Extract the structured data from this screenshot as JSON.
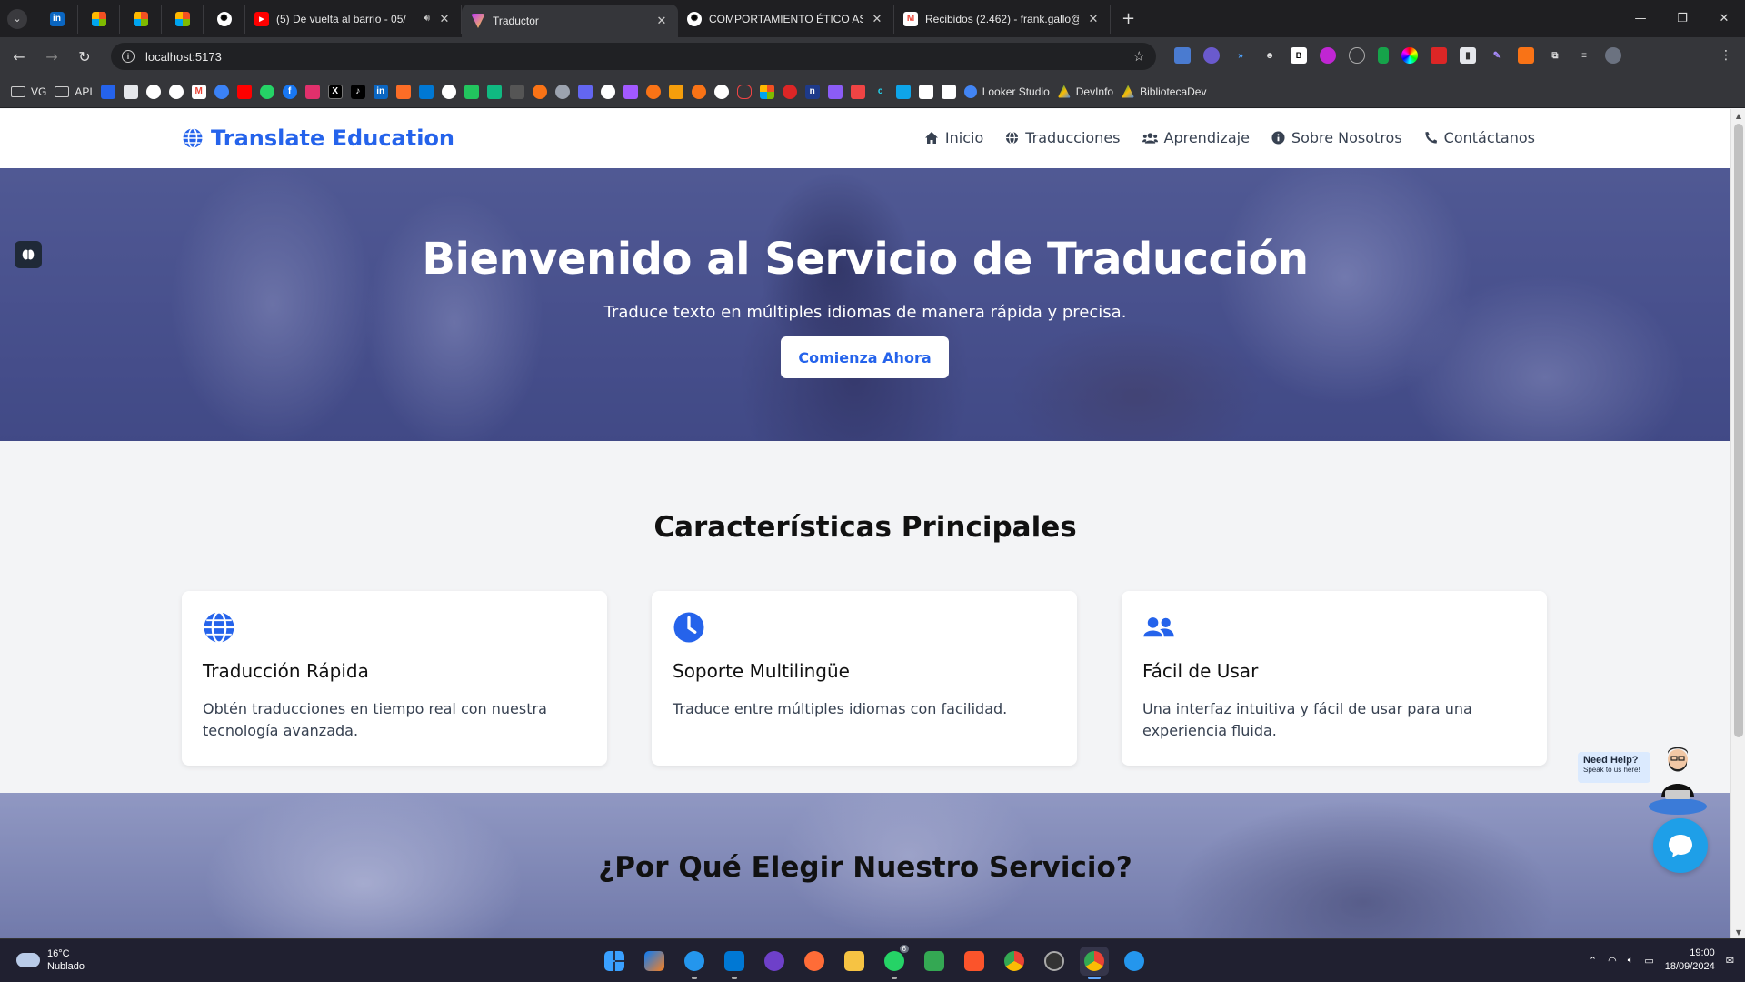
{
  "browser": {
    "tabs": [
      {
        "title": "(5) De vuelta al barrio - 05/",
        "favicon": "youtube-icon",
        "active": false
      },
      {
        "title": "Traductor",
        "favicon": "vite-icon",
        "active": true
      },
      {
        "title": "COMPORTAMIENTO ÉTICO AS",
        "favicon": "chatgpt-icon",
        "active": false
      },
      {
        "title": "Recibidos (2.462) - frank.gallo@",
        "favicon": "gmail-icon",
        "active": false
      }
    ],
    "url": "localhost:5173",
    "bookmarks": {
      "folder_1": "VG",
      "folder_2": "API",
      "named_1": "Looker Studio",
      "named_2": "DevInfo",
      "named_3": "BibliotecaDev"
    }
  },
  "site": {
    "brand": "Translate Education",
    "nav": {
      "inicio": "Inicio",
      "traducciones": "Traducciones",
      "aprendizaje": "Aprendizaje",
      "sobre": "Sobre Nosotros",
      "contacto": "Contáctanos"
    },
    "hero": {
      "title": "Bienvenido al Servicio de Traducción",
      "subtitle": "Traduce texto en múltiples idiomas de manera rápida y precisa.",
      "cta": "Comienza Ahora"
    },
    "features": {
      "title": "Características Principales",
      "items": [
        {
          "icon": "globe-icon",
          "title": "Traducción Rápida",
          "text": "Obtén traducciones en tiempo real con nuestra tecnología avanzada."
        },
        {
          "icon": "clock-icon",
          "title": "Soporte Multilingüe",
          "text": "Traduce entre múltiples idiomas con facilidad."
        },
        {
          "icon": "users-icon",
          "title": "Fácil de Usar",
          "text": "Una interfaz intuitiva y fácil de usar para una experiencia fluida."
        }
      ]
    },
    "why_title": "¿Por Qué Elegir Nuestro Servicio?",
    "help": {
      "title": "Need Help?",
      "subtitle": "Speak to us here!"
    }
  },
  "taskbar": {
    "weather_temp": "16°C",
    "weather_desc": "Nublado",
    "time": "19:00",
    "date": "18/09/2024",
    "whatsapp_badge": "6"
  },
  "colors": {
    "brand_blue": "#2563eb",
    "page_bg": "#f3f4f6",
    "chat_blue": "#1e9fe8"
  }
}
